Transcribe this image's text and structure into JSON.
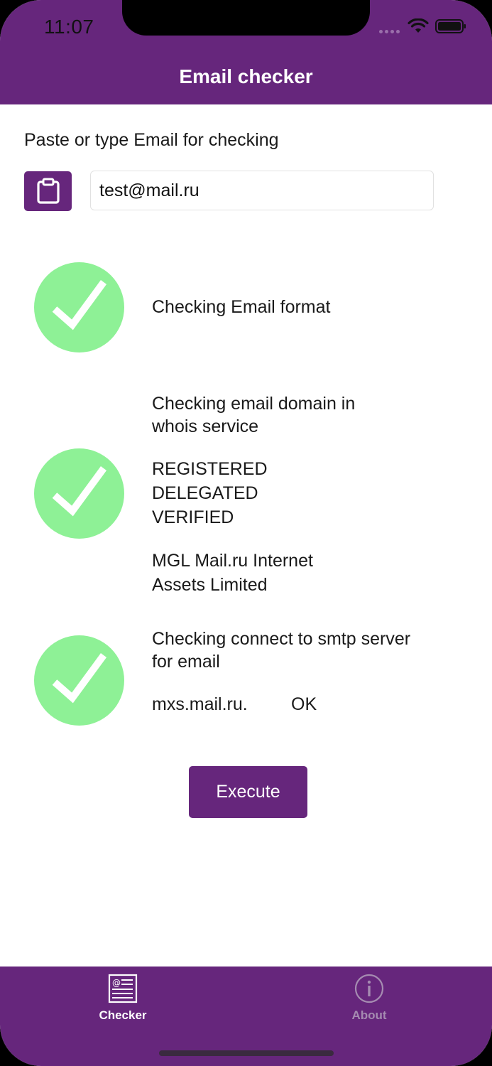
{
  "status_bar": {
    "time": "11:07"
  },
  "nav": {
    "title": "Email checker"
  },
  "form": {
    "prompt": "Paste or type Email for checking",
    "paste_icon": "clipboard-icon",
    "email_value": "test@mail.ru"
  },
  "checks": [
    {
      "status": "passed",
      "lines": [
        "Checking Email format"
      ]
    },
    {
      "status": "passed",
      "title_lines": [
        "Checking email domain in",
        "whois service"
      ],
      "status_lines": [
        "REGISTERED",
        "DELEGATED",
        "VERIFIED"
      ],
      "owner_lines": [
        "MGL Mail.ru Internet",
        "Assets Limited"
      ]
    },
    {
      "status": "passed",
      "title_lines": [
        "Checking connect to smtp server",
        "for email"
      ],
      "server": "mxs.mail.ru.",
      "result": "OK"
    }
  ],
  "actions": {
    "execute_label": "Execute"
  },
  "tabbar": {
    "tabs": [
      {
        "label": "Checker",
        "icon": "checker-icon",
        "selected": true
      },
      {
        "label": "About",
        "icon": "info-icon",
        "selected": false
      }
    ]
  },
  "colors": {
    "brand": "#66267c",
    "success": "#8ef196",
    "tab_inactive": "#a58bb1"
  }
}
